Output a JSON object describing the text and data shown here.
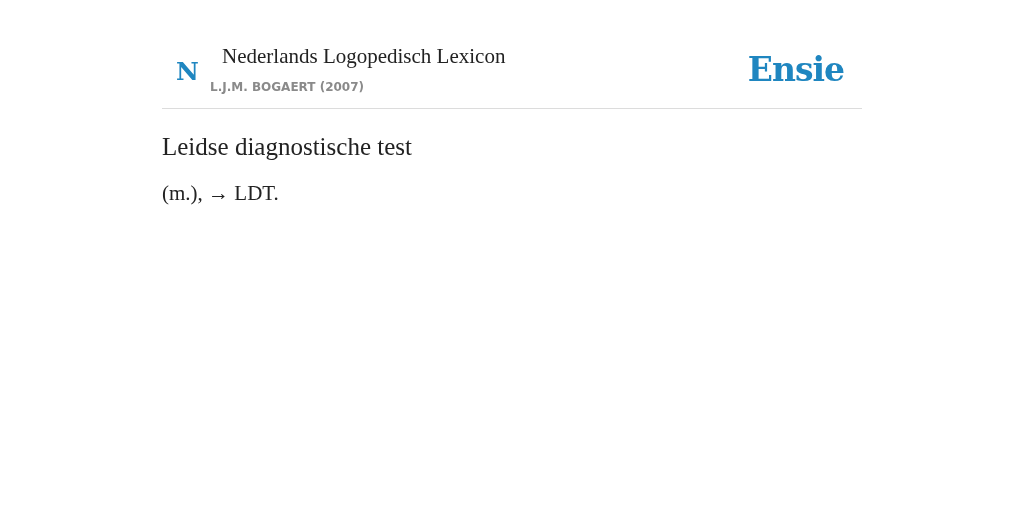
{
  "header": {
    "badge": "N",
    "title": "Nederlands Logopedisch Lexicon",
    "author": "L.J.M. BOGAERT (2007)",
    "logo": "Ensie"
  },
  "entry": {
    "term": "Leidse diagnostische test",
    "definition": "(m.), → LDT."
  }
}
